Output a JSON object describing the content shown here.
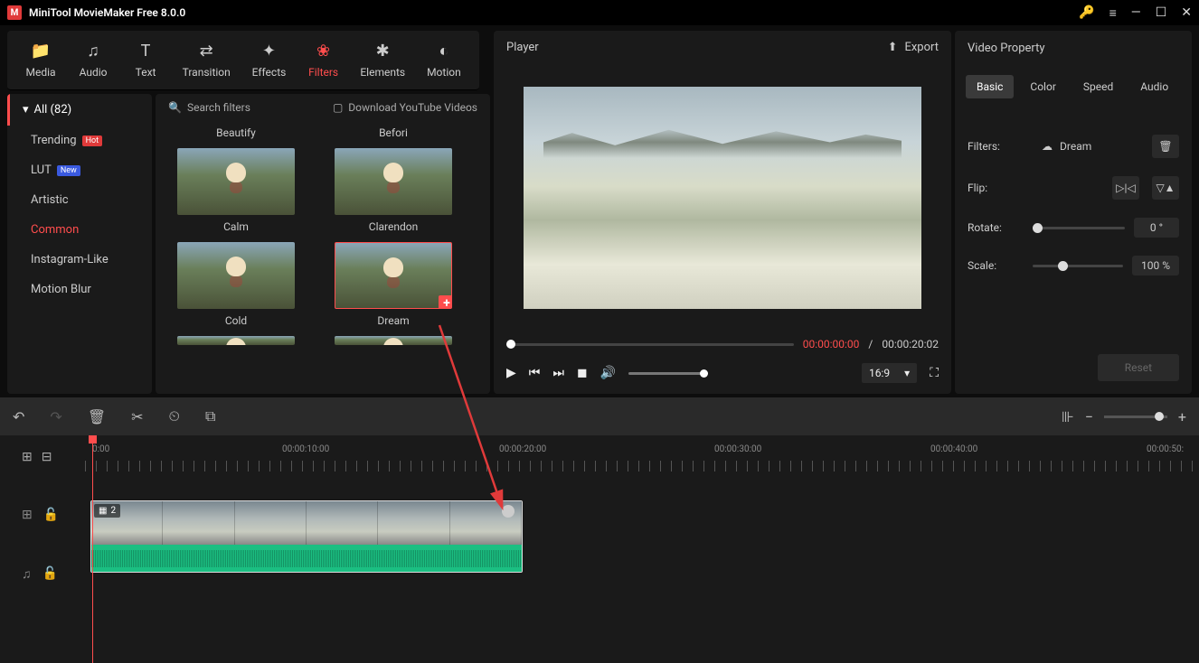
{
  "app": {
    "title": "MiniTool MovieMaker Free 8.0.0"
  },
  "nav": {
    "media": "Media",
    "audio": "Audio",
    "text": "Text",
    "transition": "Transition",
    "effects": "Effects",
    "filters": "Filters",
    "elements": "Elements",
    "motion": "Motion"
  },
  "sidebar": {
    "all": "All (82)",
    "cats": [
      "Trending",
      "LUT",
      "Artistic",
      "Common",
      "Instagram-Like",
      "Motion Blur"
    ],
    "badges": {
      "0": "Hot",
      "1": "New"
    }
  },
  "filterPanel": {
    "search": "Search filters",
    "yt": "Download YouTube Videos",
    "items": [
      "Beautify",
      "Befori",
      "Calm",
      "Clarendon",
      "Cold",
      "Dream"
    ]
  },
  "player": {
    "title": "Player",
    "export": "Export",
    "time_cur": "00:00:00:00",
    "time_sep": " / ",
    "time_total": "00:00:20:02",
    "aspect": "16:9"
  },
  "props": {
    "title": "Video Property",
    "tabs": [
      "Basic",
      "Color",
      "Speed",
      "Audio"
    ],
    "filters_label": "Filters:",
    "filter_name": "Dream",
    "flip_label": "Flip:",
    "rotate_label": "Rotate:",
    "rotate_val": "0 °",
    "scale_label": "Scale:",
    "scale_val": "100 %",
    "reset": "Reset"
  },
  "timeline": {
    "clip_count": "2",
    "marks": [
      "0:00",
      "00:00:10:00",
      "00:00:20:00",
      "00:00:30:00",
      "00:00:40:00",
      "00:00:50:"
    ]
  }
}
